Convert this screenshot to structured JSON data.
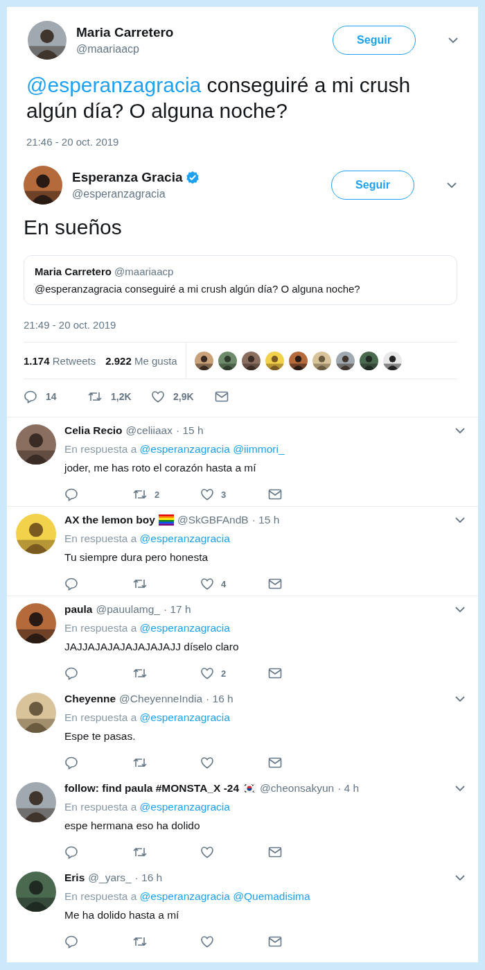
{
  "original_tweet": {
    "name": "Maria Carretero",
    "handle": "@maariaacp",
    "follow_label": "Seguir",
    "mention": "@esperanzagracia",
    "text": "conseguiré a mi crush algún día? O alguna noche?",
    "timestamp": "21:46 - 20 oct. 2019"
  },
  "answer_tweet": {
    "name": "Esperanza Gracia",
    "verified": true,
    "handle": "@esperanzagracia",
    "follow_label": "Seguir",
    "text": "En sueños",
    "quoted": {
      "name": "Maria Carretero",
      "handle": "@maariaacp",
      "text": "@esperanzagracia conseguiré a mi crush algún día? O alguna noche?"
    },
    "timestamp": "21:49 - 20 oct. 2019",
    "stats": [
      {
        "count": "1.174",
        "label": "Retweets"
      },
      {
        "count": "2.922",
        "label": "Me gusta"
      }
    ],
    "actions": {
      "replies": "14",
      "retweets": "1,2K",
      "likes": "2,9K"
    }
  },
  "replies": [
    {
      "name": "Celia Recio",
      "kind": "plain",
      "handle": "@celiiaax",
      "time": "· 15 h",
      "reply_prefix": "En respuesta a",
      "mentions": [
        "@esperanzagracia",
        "@iimmori_"
      ],
      "text": "joder, me has roto el corazón hasta a mí",
      "retweets": "2",
      "likes": "3",
      "divider_below": true
    },
    {
      "name": "AX the lemon boy",
      "kind": "rainbow-flag",
      "handle": "@SkGBFAndB",
      "time": "· 15 h",
      "reply_prefix": "En respuesta a",
      "mentions": [
        "@esperanzagracia"
      ],
      "text": "Tu siempre dura pero honesta",
      "likes": "4",
      "divider_below": true
    },
    {
      "name": "paula",
      "kind": "plain",
      "handle": "@pauulamg_",
      "time": "· 17 h",
      "reply_prefix": "En respuesta a",
      "mentions": [
        "@esperanzagracia"
      ],
      "text": "JAJJAJAJAJAJAJAJAJJ díselo claro",
      "likes": "2",
      "divider_below": false
    },
    {
      "name": "Cheyenne",
      "kind": "plain",
      "handle": "@CheyenneIndia",
      "time": "· 16 h",
      "reply_prefix": "En respuesta a",
      "mentions": [
        "@esperanzagracia"
      ],
      "text": "Espe te pasas.",
      "divider_below": false
    },
    {
      "name": "follow: find paula #MONSTA_X -24",
      "kind": "korea-flag",
      "handle": "@cheonsakyun",
      "time": "· 4 h",
      "reply_prefix": "En respuesta a",
      "mentions": [
        "@esperanzagracia"
      ],
      "text": "espe hermana eso ha dolido",
      "divider_below": false
    },
    {
      "name": "Eris",
      "kind": "plain",
      "handle": "@_yars_",
      "time": "· 16 h",
      "reply_prefix": "En respuesta a",
      "mentions": [
        "@esperanzagracia",
        "@Quemadisima"
      ],
      "text": "Me ha dolido hasta a mí",
      "divider_below": false
    }
  ]
}
